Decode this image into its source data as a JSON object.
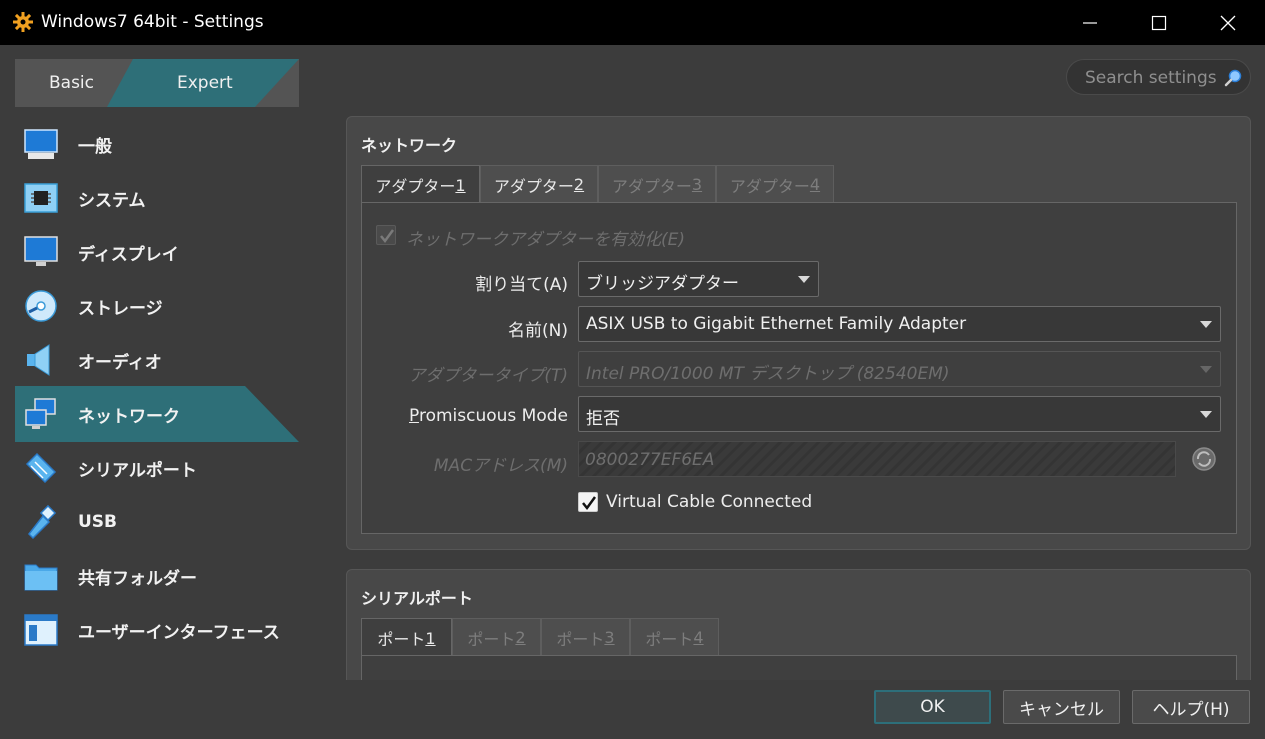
{
  "window": {
    "title": "Windows7 64bit - Settings"
  },
  "mode": {
    "basic_label": "Basic",
    "expert_label": "Expert",
    "selected": "Expert"
  },
  "search": {
    "placeholder": "Search settings"
  },
  "sidebar": {
    "items": [
      {
        "label": "一般",
        "icon": "general-icon"
      },
      {
        "label": "システム",
        "icon": "system-chip-icon"
      },
      {
        "label": "ディスプレイ",
        "icon": "display-monitor-icon"
      },
      {
        "label": "ストレージ",
        "icon": "storage-disk-icon"
      },
      {
        "label": "オーディオ",
        "icon": "audio-speaker-icon"
      },
      {
        "label": "ネットワーク",
        "icon": "network-icon",
        "selected": true
      },
      {
        "label": "シリアルポート",
        "icon": "serial-port-icon"
      },
      {
        "label": "USB",
        "icon": "usb-icon"
      },
      {
        "label": "共有フォルダー",
        "icon": "shared-folder-icon"
      },
      {
        "label": "ユーザーインターフェース",
        "icon": "user-interface-icon"
      }
    ]
  },
  "network": {
    "group_title": "ネットワーク",
    "tabs": [
      {
        "label": "アダプター ",
        "hotkey": "1",
        "active": true,
        "enabled": true
      },
      {
        "label": "アダプター ",
        "hotkey": "2",
        "active": false,
        "enabled": true
      },
      {
        "label": "アダプター ",
        "hotkey": "3",
        "active": false,
        "enabled": false
      },
      {
        "label": "アダプター ",
        "hotkey": "4",
        "active": false,
        "enabled": false
      }
    ],
    "enable_adapter_label": "ネットワークアダプターを有効化(E)",
    "enable_adapter_checked": true,
    "attached_label": "割り当て(A)",
    "attached_value": "ブリッジアダプター",
    "name_label": "名前(N)",
    "name_value": "ASIX USB to Gigabit Ethernet Family Adapter",
    "adapter_type_label": "アダプタータイプ(T)",
    "adapter_type_value": "Intel PRO/1000 MT デスクトップ (82540EM)",
    "promiscuous_label": "Promiscuous Mode",
    "promiscuous_value": "拒否",
    "mac_label": "MACアドレス(M)",
    "mac_value": "0800277EF6EA",
    "cable_label": "Virtual Cable Connected",
    "cable_checked": true
  },
  "serial": {
    "group_title": "シリアルポート",
    "tabs": [
      {
        "label": "ポート ",
        "hotkey": "1",
        "active": true,
        "enabled": true
      },
      {
        "label": "ポート ",
        "hotkey": "2",
        "active": false,
        "enabled": false
      },
      {
        "label": "ポート ",
        "hotkey": "3",
        "active": false,
        "enabled": false
      },
      {
        "label": "ポート ",
        "hotkey": "4",
        "active": false,
        "enabled": false
      }
    ]
  },
  "buttons": {
    "ok": "OK",
    "cancel": "キャンセル",
    "help": "ヘルプ(H)"
  },
  "colors": {
    "accent": "#2e6f78",
    "background": "#3c3c3c",
    "titlebar": "#000000"
  }
}
